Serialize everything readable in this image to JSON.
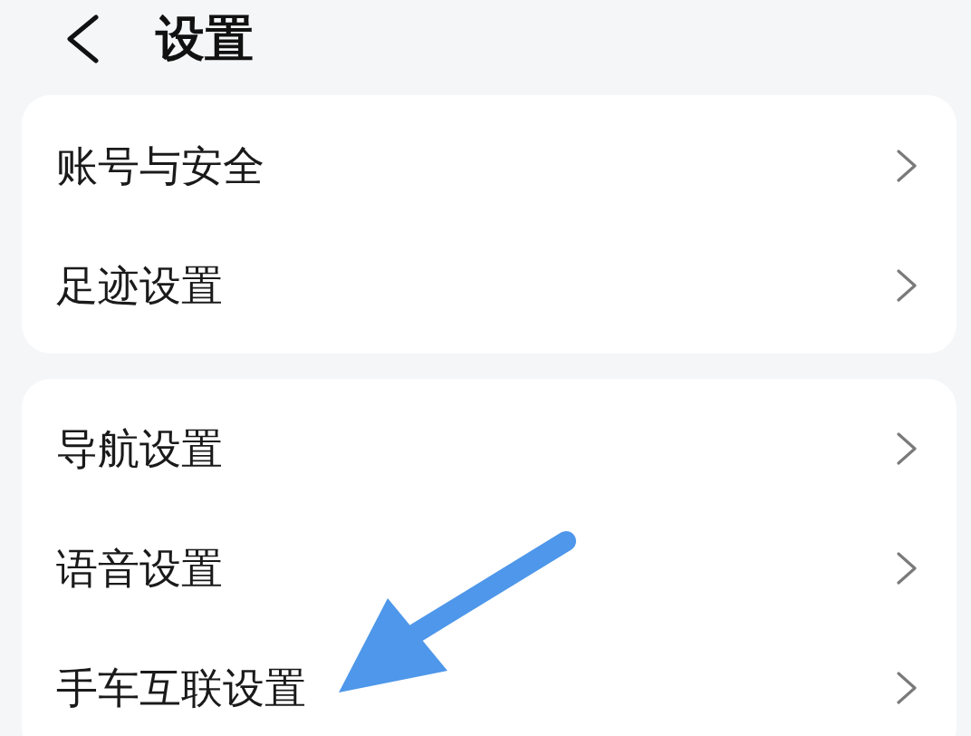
{
  "header": {
    "title": "设置"
  },
  "groups": [
    {
      "items": [
        {
          "label": "账号与安全"
        },
        {
          "label": "足迹设置"
        }
      ]
    },
    {
      "items": [
        {
          "label": "导航设置"
        },
        {
          "label": "语音设置"
        },
        {
          "label": "手车互联设置"
        }
      ]
    }
  ]
}
